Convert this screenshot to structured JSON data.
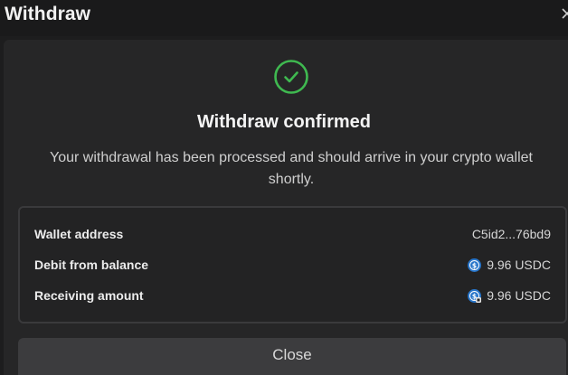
{
  "dialog": {
    "title": "Withdraw",
    "heading": "Withdraw confirmed",
    "message": "Your withdrawal has been processed and should arrive in your crypto wallet shortly.",
    "close_label": "Close"
  },
  "details": [
    {
      "label": "Wallet address",
      "value": "C5id2...76bd9",
      "icon": null
    },
    {
      "label": "Debit from balance",
      "value": "9.96 USDC",
      "icon": "usdc-icon"
    },
    {
      "label": "Receiving amount",
      "value": "9.96 USDC",
      "icon": "usdc-network-icon"
    }
  ],
  "colors": {
    "success": "#3fb950",
    "usdc": "#2775ca"
  }
}
